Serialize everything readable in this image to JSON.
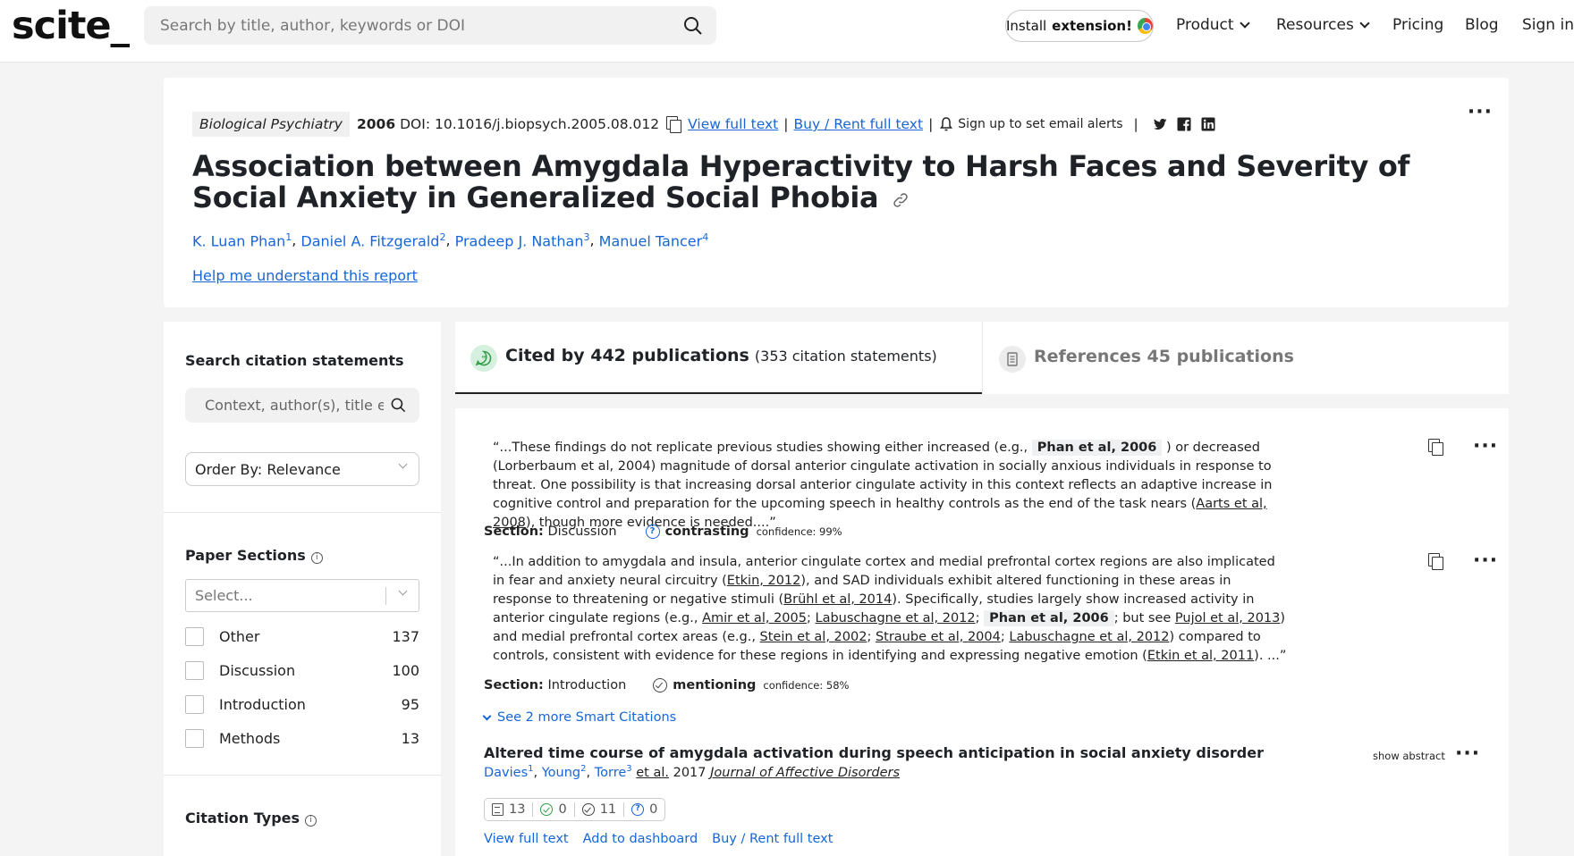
{
  "nav": {
    "logo": "scite_",
    "search_placeholder": "Search by title, author, keywords or DOI",
    "install_prefix": "Install",
    "install_bold": "extension!",
    "items": [
      "Product",
      "Resources",
      "Pricing",
      "Blog",
      "Sign in"
    ]
  },
  "paper": {
    "journal": "Biological Psychiatry",
    "year": "2006",
    "doi": "DOI: 10.1016/j.biopsych.2005.08.012",
    "view_full_text": "View full text",
    "buy_rent": "Buy / Rent full text",
    "email_alerts": "Sign up to set email alerts",
    "title": "Association between Amygdala Hyperactivity to Harsh Faces and Severity of Social Anxiety in Generalized Social Phobia",
    "authors": [
      {
        "name": "K. Luan Phan",
        "sup": "1"
      },
      {
        "name": "Daniel A. Fitzgerald",
        "sup": "2"
      },
      {
        "name": "Pradeep J. Nathan",
        "sup": "3"
      },
      {
        "name": "Manuel Tancer",
        "sup": "4"
      }
    ],
    "help_link": "Help me understand this report"
  },
  "sidebar": {
    "search_heading": "Search citation statements",
    "search_placeholder": "Context, author(s), title etc.",
    "order_by": "Order By: Relevance",
    "sections_heading": "Paper Sections",
    "sections_select_placeholder": "Select...",
    "sections": [
      {
        "label": "Other",
        "count": "137"
      },
      {
        "label": "Discussion",
        "count": "100"
      },
      {
        "label": "Introduction",
        "count": "95"
      },
      {
        "label": "Methods",
        "count": "13"
      }
    ],
    "citation_types_heading": "Citation Types"
  },
  "tabs": {
    "cited_by": "Cited by 442 publications",
    "cited_statements": "(353 citation statements)",
    "references": "References 45 publications"
  },
  "citations": [
    {
      "q1": "“...These findings do not replicate previous studies showing either increased (e.g.,",
      "hl": "Phan et al, 2006",
      "q2": ") or decreased (Lorberbaum et al, 2004) magnitude of dorsal anterior cingulate activation in socially anxious individuals in response to threat. One possibility is that increasing dorsal anterior cingulate activity in this context reflects an adaptive increase in cognitive control and preparation for the upcoming speech in healthy controls as the end of the task nears (",
      "ref": "Aarts et al, 2008",
      "q3": "), though more evidence is needed....”",
      "section_label": "Section:",
      "section": "Discussion",
      "type": "contrasting",
      "confidence": "confidence: 99%"
    },
    {
      "q1": "“...In addition to amygdala and insula, anterior cingulate cortex and medial prefrontal cortex regions are also implicated in fear and anxiety neural circuitry (",
      "r1": "Etkin, 2012",
      "q2": "), and SAD individuals exhibit altered functioning in these areas in response to threatening or negative stimuli (",
      "r2": "Brühl et al, 2014",
      "q3": "). Specifically, studies largely show increased activity in anterior cingulate regions (e.g.,",
      "r3": "Amir et al, 2005",
      "sep1": ";",
      "r4": "Labuschagne et al, 2012",
      "sep2": ";",
      "hl": "Phan et al, 2006",
      "q4": "; but see",
      "r5": "Pujol et al, 2013",
      "q5": ") and medial prefrontal cortex areas (e.g.,",
      "r6": "Stein et al, 2002",
      "sep3": ";",
      "r7": "Straube et al, 2004",
      "sep4": ";",
      "r8": "Labuschagne et al, 2012",
      "q6": ") compared to controls, consistent with evidence for these regions in identifying and expressing negative emotion (",
      "r9": "Etkin et al, 2011",
      "q7": "). ...”",
      "section_label": "Section:",
      "section": "Introduction",
      "type": "mentioning",
      "confidence": "confidence: 58%"
    }
  ],
  "see_more": "See 2 more Smart Citations",
  "result": {
    "title": "Altered time course of amygdala activation during speech anticipation in social anxiety disorder",
    "authors": [
      {
        "name": "Davies",
        "sup": "1"
      },
      {
        "name": "Young",
        "sup": "2"
      },
      {
        "name": "Torre",
        "sup": "3"
      }
    ],
    "etal": "et al.",
    "year": "2017",
    "journal": "Journal of Affective Disorders",
    "show_abstract": "show abstract",
    "tallies": {
      "total": "13",
      "supporting": "0",
      "mentioning": "11",
      "contrasting": "0"
    },
    "actions": [
      "View full text",
      "Add to dashboard",
      "Buy / Rent full text"
    ]
  }
}
